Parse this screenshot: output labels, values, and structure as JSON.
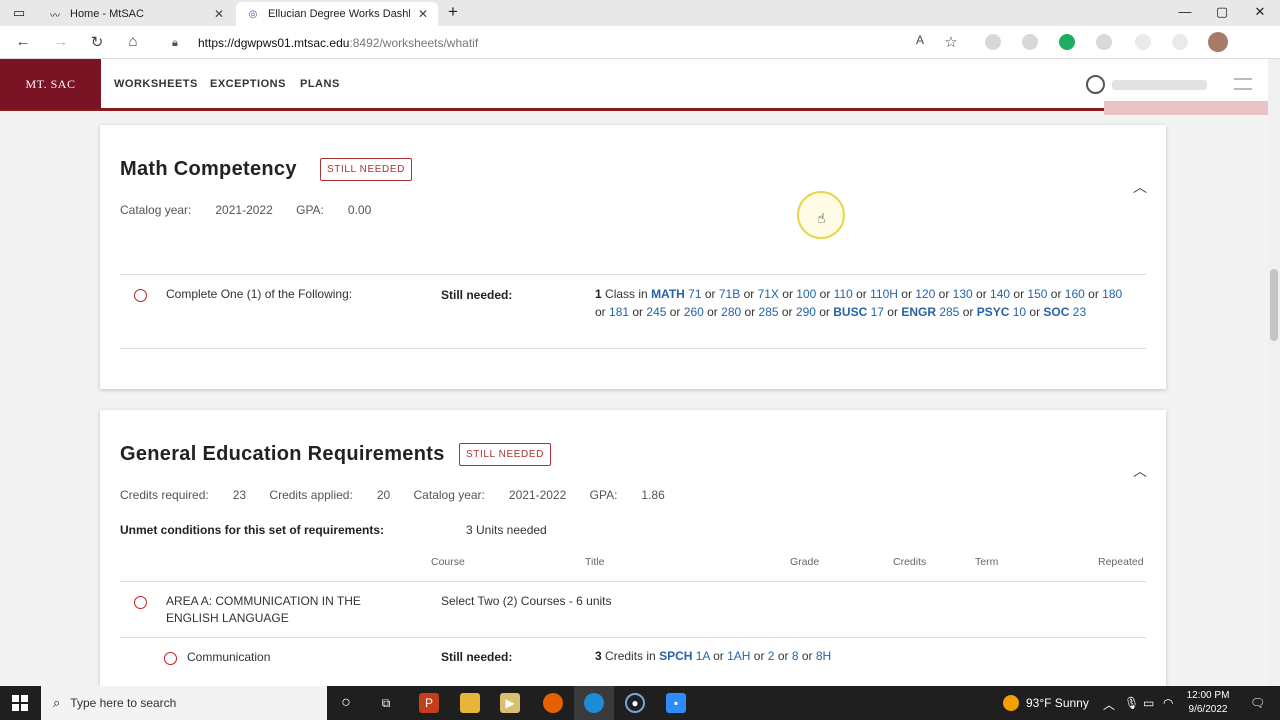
{
  "browser": {
    "tabs": [
      {
        "title": "Home - MtSAC",
        "active": false
      },
      {
        "title": "Ellucian Degree Works Dashboar",
        "active": true
      }
    ],
    "new_tab": "+",
    "url_host": "https://dgwpws01.mtsac.edu",
    "url_path": ":8492/worksheets/whatif"
  },
  "app": {
    "logo_text": "MT. SAC",
    "nav": [
      "WORKSHEETS",
      "EXCEPTIONS",
      "PLANS"
    ]
  },
  "math": {
    "title": "Math Competency",
    "badge": "STILL NEEDED",
    "catalog_label": "Catalog year:",
    "catalog_value": "2021-2022",
    "gpa_label": "GPA:",
    "gpa_value": "0.00",
    "requirement_label": "Complete One (1) of the Following:",
    "still_needed_label": "Still needed:",
    "count": "1",
    "count_unit": "Class in",
    "courses_html_note": "",
    "course_groups": [
      {
        "subject": "MATH",
        "numbers": [
          "71",
          "71B",
          "71X",
          "100",
          "110",
          "110H",
          "120",
          "130",
          "140",
          "150",
          "160",
          "180",
          "181",
          "245",
          "260",
          "280",
          "285",
          "290"
        ]
      },
      {
        "subject": "BUSC",
        "numbers": [
          "17"
        ]
      },
      {
        "subject": "ENGR",
        "numbers": [
          "285"
        ]
      },
      {
        "subject": "PSYC",
        "numbers": [
          "10"
        ]
      },
      {
        "subject": "SOC",
        "numbers": [
          "23"
        ]
      }
    ],
    "connector": "or"
  },
  "gen_ed": {
    "title": "General Education Requirements",
    "badge": "STILL NEEDED",
    "credits_required_label": "Credits required:",
    "credits_required_value": "23",
    "credits_applied_label": "Credits applied:",
    "credits_applied_value": "20",
    "catalog_label": "Catalog year:",
    "catalog_value": "2021-2022",
    "gpa_label": "GPA:",
    "gpa_value": "1.86",
    "unmet_label": "Unmet conditions for this set of requirements:",
    "unmet_value": "3 Units needed",
    "columns": [
      "Course",
      "Title",
      "Grade",
      "Credits",
      "Term",
      "Repeated"
    ],
    "area_a_label": "AREA A: COMMUNICATION IN THE ENGLISH LANGUAGE",
    "area_a_detail": "Select Two (2) Courses - 6 units",
    "comm_label": "Communication",
    "still_needed_label": "Still needed:",
    "comm_count": "3",
    "comm_unit": "Credits in",
    "comm_subject": "SPCH",
    "comm_numbers": [
      "1A",
      "1AH",
      "2",
      "8",
      "8H"
    ]
  },
  "taskbar": {
    "search_placeholder": "Type here to search",
    "weather": "93°F  Sunny",
    "time": "12:00 PM",
    "date": "9/6/2022"
  },
  "colors": {
    "brand": "#7a1425",
    "link": "#2563a8",
    "badge": "#aa3333"
  }
}
